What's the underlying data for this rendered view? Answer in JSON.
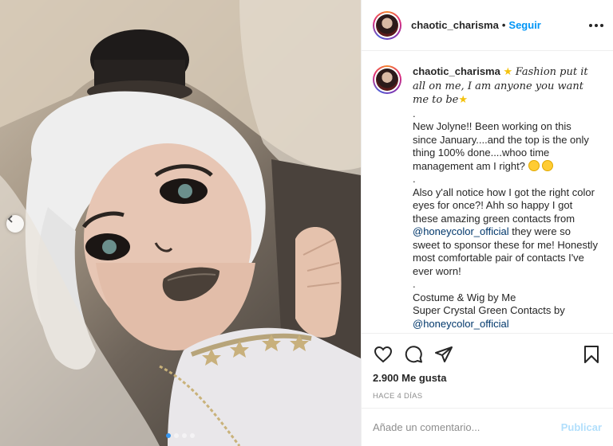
{
  "post": {
    "username": "chaotic_charisma",
    "separator": "•",
    "follow_label": "Seguir"
  },
  "caption": {
    "username": "chaotic_charisma",
    "quote_line": "Fashion put it all on me, I am anyone you want me to be",
    "dot1": ".",
    "para1": "New Jolyne!! Been working on this since January....and the top is the only thing 100% done....whoo time management am I right?",
    "dot2": ".",
    "para2_before": "Also y'all notice how I got the right color eyes for once?! Ahh so happy I got these amazing green contacts from ",
    "mention1": "@honeycolor_official",
    "para2_after": " they were so sweet to sponsor these for me! Honestly most comfortable pair of contacts I've ever worn!",
    "dot3": ".",
    "credits_line1": "Costume & Wig by Me",
    "credits_line2": "Super Crystal Green Contacts by",
    "mention2": "@honeycolor_official"
  },
  "stats": {
    "likes": "2.900 Me gusta",
    "time": "HACE 4 DÍAS"
  },
  "comment": {
    "placeholder": "Añade un comentario...",
    "publish_label": "Publicar"
  },
  "carousel": {
    "dot_count": 4,
    "active_index": 0
  },
  "colors": {
    "link_blue": "#0095f6",
    "mention_blue": "#00376b",
    "publish_disabled": "#b2dffc",
    "muted": "#8e8e8e"
  },
  "icons": [
    "heart-icon",
    "comment-icon",
    "share-icon",
    "bookmark-icon",
    "more-icon",
    "chevron-left-icon",
    "star-emoji",
    "grin-emoji"
  ]
}
